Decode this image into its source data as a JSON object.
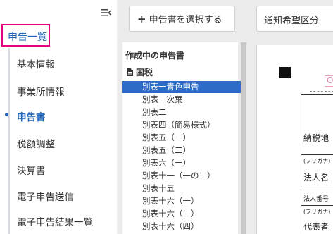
{
  "left_nav": {
    "active_item": "申告一覧",
    "items": [
      {
        "label": "基本情報",
        "current": false
      },
      {
        "label": "事業所情報",
        "current": false
      },
      {
        "label": "申告書",
        "current": true
      },
      {
        "label": "税額調整",
        "current": false
      },
      {
        "label": "決算書",
        "current": false
      },
      {
        "label": "電子申告送信",
        "current": false
      },
      {
        "label": "電子申告結果一覧",
        "current": false
      }
    ]
  },
  "middle": {
    "select_button_plus": "+",
    "select_button_label": "申告書を選択する",
    "list_heading": "作成中の申告書",
    "group_label": "国税",
    "forms": [
      {
        "label": "別表一青色申告",
        "selected": true
      },
      {
        "label": "別表一次葉",
        "selected": false
      },
      {
        "label": "別表二",
        "selected": false
      },
      {
        "label": "別表四（簡易様式）",
        "selected": false
      },
      {
        "label": "別表五（一）",
        "selected": false
      },
      {
        "label": "別表五（二）",
        "selected": false
      },
      {
        "label": "別表六（一）",
        "selected": false
      },
      {
        "label": "別表十一（一の二）",
        "selected": false
      },
      {
        "label": "別表十五",
        "selected": false
      },
      {
        "label": "別表十六（一）",
        "selected": false
      },
      {
        "label": "別表十六（二）",
        "selected": false
      },
      {
        "label": "別表十六（四）",
        "selected": false
      }
    ]
  },
  "right": {
    "notice_button_label": "通知希望区分",
    "preview": {
      "pink_char": "O",
      "row_taxplace": "納税地",
      "row_furigana1": "(フリガナ)",
      "row_corpname": "法人名",
      "row_corpnum": "法人番号",
      "row_furigana2": "(フリガナ)",
      "row_rep": "代表者"
    }
  },
  "colors": {
    "accent_blue": "#1f63b7",
    "selected_bg": "#2d6bc9",
    "highlight_pink": "#e6007e",
    "panel_gray": "#ebebeb"
  },
  "icons": {
    "collapse": "collapse-sidebar-icon",
    "plus": "plus-icon",
    "document": "document-icon"
  }
}
